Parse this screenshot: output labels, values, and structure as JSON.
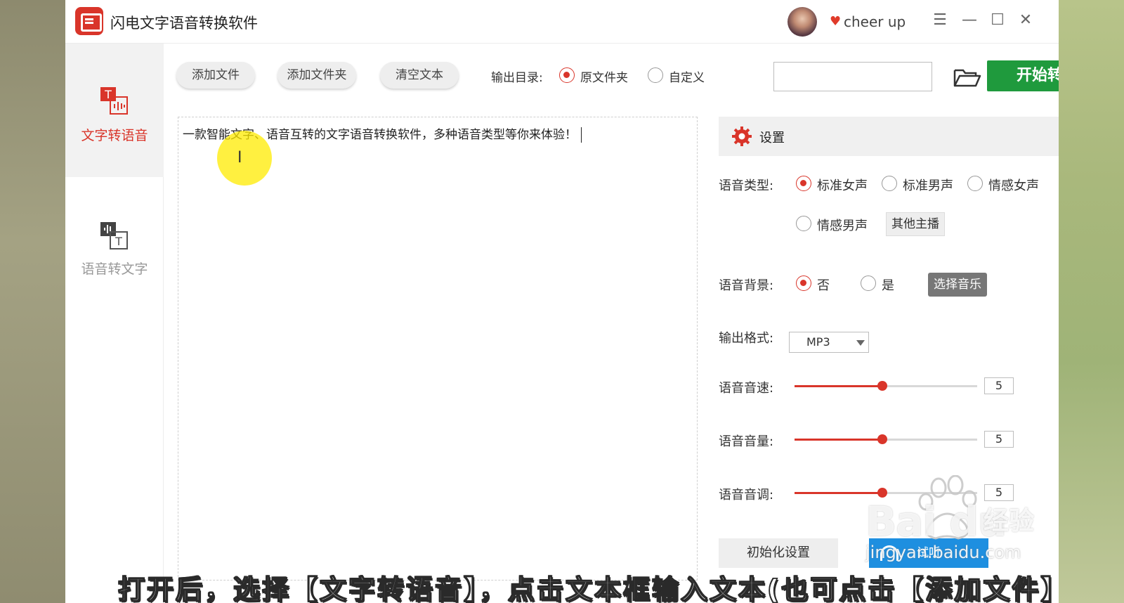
{
  "app": {
    "title": "闪电文字语音转换软件",
    "user_name": "cheer up"
  },
  "sidebar": {
    "items": [
      {
        "label": "文字转语音",
        "active": true
      },
      {
        "label": "语音转文字",
        "active": false
      }
    ]
  },
  "toolbar": {
    "add_file": "添加文件",
    "add_folder": "添加文件夹",
    "clear_text": "清空文本",
    "output_dir_label": "输出目录:",
    "output_options": [
      "原文件夹",
      "自定义"
    ],
    "output_selected": "原文件夹",
    "path_value": "",
    "start_button": "开始转换"
  },
  "editor": {
    "text": "一款智能文字、语音互转的文字语音转换软件，多种语音类型等你来体验！"
  },
  "settings": {
    "title": "设置",
    "voice_type_label": "语音类型:",
    "voice_types": [
      "标准女声",
      "标准男声",
      "情感女声",
      "情感男声"
    ],
    "voice_type_selected": "标准女声",
    "other_anchor_button": "其他主播",
    "background_label": "语音背景:",
    "background_options": [
      "否",
      "是"
    ],
    "background_selected": "否",
    "choose_music_button": "选择音乐",
    "format_label": "输出格式:",
    "format_value": "MP3",
    "speed_label": "语音音速:",
    "speed_value": "5",
    "volume_label": "语音音量:",
    "volume_value": "5",
    "pitch_label": "语音音调:",
    "pitch_value": "5",
    "slider_max": 10,
    "reset_button": "初始化设置",
    "listen_button": "试听"
  },
  "watermark": {
    "brand": "Bai du",
    "brand_cn": "经验",
    "url": "jingyan.baidu.com"
  },
  "subtitle": "打开后，选择【文字转语音】，点击文本框输入文本(也可点击【添加文件】",
  "colors": {
    "accent_red": "#d9352a",
    "start_green": "#1f9a3d",
    "listen_blue": "#1e8fe0"
  }
}
